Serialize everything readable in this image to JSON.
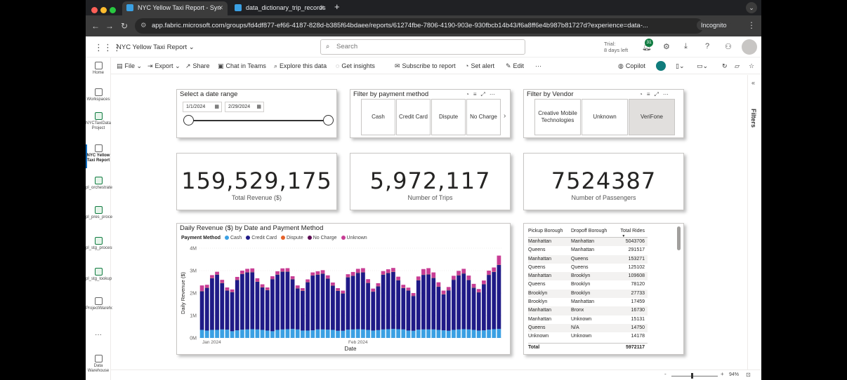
{
  "browser": {
    "tabs": [
      {
        "title": "NYC Yellow Taxi Report - Syn"
      },
      {
        "title": "data_dictionary_trip_records"
      }
    ],
    "url": "app.fabric.microsoft.com/groups/fd4df877-ef66-4187-828d-b385f64bdaee/reports/61274fbe-7806-4190-903e-930fbcb14b43/f6a8ff6e4b987b81727d?experience=data-...",
    "incognito_label": "Incognito"
  },
  "header": {
    "report_title": "NYC Yellow Taxi Report",
    "search_placeholder": "Search",
    "trial_line1": "Trial:",
    "trial_line2": "8 days left",
    "notification_count": "31"
  },
  "toolbar": {
    "file": "File",
    "export": "Export",
    "share": "Share",
    "chat_in_teams": "Chat in Teams",
    "explore": "Explore this data",
    "insights": "Get insights",
    "subscribe": "Subscribe to report",
    "set_alert": "Set alert",
    "edit": "Edit",
    "more": "···",
    "copilot": "Copilot"
  },
  "leftnav": {
    "items": [
      {
        "label": "Home"
      },
      {
        "label": "Workspaces"
      },
      {
        "label": "NYCTaxiData Project"
      },
      {
        "label": "NYC Yellow Taxi Report"
      },
      {
        "label": "pl_orchestrate_nyctaxi"
      },
      {
        "label": "pl_pres_processing_nyc..."
      },
      {
        "label": "pl_stg_processing_nyct..."
      },
      {
        "label": "pl_stg_lookup"
      },
      {
        "label": "ProjectWarehouse"
      },
      {
        "label": "···"
      },
      {
        "label": "Data Warehouse"
      }
    ]
  },
  "date_slicer": {
    "title": "Select a date range",
    "start": "1/1/2024",
    "end": "2/29/2024"
  },
  "payment_filter": {
    "title": "Filter by payment method",
    "options": [
      "Cash",
      "Credit Card",
      "Dispute",
      "No Charge"
    ]
  },
  "vendor_filter": {
    "title": "Filter by Vendor",
    "options": [
      "Creative Mobile Technologies",
      "Unknown",
      "VeriFone"
    ]
  },
  "kpis": [
    {
      "value": "159,529,175",
      "label": "Total Revenue ($)"
    },
    {
      "value": "5,972,117",
      "label": "Number of Trips"
    },
    {
      "value": "7524387",
      "label": "Number of Passengers"
    }
  ],
  "chart_data": {
    "type": "bar",
    "title": "Daily Revenue ($) by Date and Payment Method",
    "legend_title": "Payment Method",
    "xlabel": "Date",
    "ylabel": "Daily Revenue ($)",
    "x_tick_labels": [
      "Jan 2024",
      "Feb 2024"
    ],
    "y_tick_labels": [
      "0M",
      "1M",
      "2M",
      "3M",
      "4M"
    ],
    "ylim": [
      0,
      4000000
    ],
    "colors": {
      "Cash": "#3aa0e3",
      "Credit Card": "#1f1a87",
      "Dispute": "#e6632b",
      "No Charge": "#5c0a52",
      "Unknown": "#c83d95"
    },
    "categories": [
      "Jan 1",
      "Jan 2",
      "Jan 3",
      "Jan 4",
      "Jan 5",
      "Jan 6",
      "Jan 7",
      "Jan 8",
      "Jan 9",
      "Jan 10",
      "Jan 11",
      "Jan 12",
      "Jan 13",
      "Jan 14",
      "Jan 15",
      "Jan 16",
      "Jan 17",
      "Jan 18",
      "Jan 19",
      "Jan 20",
      "Jan 21",
      "Jan 22",
      "Jan 23",
      "Jan 24",
      "Jan 25",
      "Jan 26",
      "Jan 27",
      "Jan 28",
      "Jan 29",
      "Jan 30",
      "Jan 31",
      "Feb 1",
      "Feb 2",
      "Feb 3",
      "Feb 4",
      "Feb 5",
      "Feb 6",
      "Feb 7",
      "Feb 8",
      "Feb 9",
      "Feb 10",
      "Feb 11",
      "Feb 12",
      "Feb 13",
      "Feb 14",
      "Feb 15",
      "Feb 16",
      "Feb 17",
      "Feb 18",
      "Feb 19",
      "Feb 20",
      "Feb 21",
      "Feb 22",
      "Feb 23",
      "Feb 24",
      "Feb 25",
      "Feb 26",
      "Feb 27",
      "Feb 28",
      "Feb 29"
    ],
    "series": [
      {
        "name": "Cash",
        "values": [
          360000,
          330000,
          360000,
          360000,
          380000,
          370000,
          300000,
          340000,
          370000,
          380000,
          390000,
          380000,
          360000,
          330000,
          300000,
          360000,
          380000,
          390000,
          400000,
          380000,
          330000,
          330000,
          340000,
          380000,
          380000,
          370000,
          360000,
          320000,
          320000,
          370000,
          380000,
          390000,
          380000,
          360000,
          330000,
          350000,
          380000,
          390000,
          400000,
          390000,
          380000,
          330000,
          320000,
          370000,
          380000,
          380000,
          380000,
          360000,
          340000,
          320000,
          360000,
          380000,
          390000,
          380000,
          360000,
          330000,
          340000,
          370000,
          390000,
          400000
        ]
      },
      {
        "name": "Credit Card",
        "values": [
          1720000,
          1900000,
          2300000,
          2460000,
          2060000,
          1740000,
          1740000,
          2240000,
          2480000,
          2540000,
          2540000,
          2120000,
          1890000,
          1800000,
          2320000,
          2460000,
          2570000,
          2560000,
          2210000,
          1830000,
          1770000,
          2150000,
          2440000,
          2440000,
          2480000,
          2270000,
          1970000,
          1780000,
          1660000,
          2330000,
          2390000,
          2510000,
          2540000,
          2090000,
          1730000,
          1950000,
          2440000,
          2500000,
          2540000,
          2180000,
          1840000,
          1780000,
          1550000,
          2200000,
          2430000,
          2450000,
          2290000,
          1920000,
          1600000,
          1800000,
          2230000,
          2410000,
          2480000,
          2200000,
          1880000,
          1700000,
          2050000,
          2440000,
          2550000,
          2850000
        ]
      },
      {
        "name": "Dispute",
        "values": [
          10000,
          10000,
          10000,
          10000,
          10000,
          10000,
          10000,
          10000,
          10000,
          10000,
          10000,
          10000,
          10000,
          10000,
          10000,
          10000,
          10000,
          10000,
          10000,
          10000,
          10000,
          10000,
          10000,
          10000,
          10000,
          10000,
          10000,
          10000,
          10000,
          10000,
          10000,
          10000,
          10000,
          10000,
          10000,
          10000,
          10000,
          10000,
          10000,
          10000,
          10000,
          10000,
          10000,
          10000,
          10000,
          10000,
          10000,
          10000,
          10000,
          10000,
          10000,
          10000,
          10000,
          10000,
          10000,
          10000,
          10000,
          10000,
          10000,
          10000
        ]
      },
      {
        "name": "No Charge",
        "values": [
          10000,
          10000,
          10000,
          10000,
          10000,
          10000,
          10000,
          10000,
          10000,
          10000,
          10000,
          10000,
          10000,
          10000,
          10000,
          10000,
          10000,
          10000,
          10000,
          10000,
          10000,
          10000,
          10000,
          10000,
          10000,
          10000,
          10000,
          10000,
          10000,
          10000,
          10000,
          10000,
          10000,
          10000,
          10000,
          10000,
          10000,
          10000,
          10000,
          10000,
          10000,
          10000,
          10000,
          10000,
          10000,
          10000,
          10000,
          10000,
          10000,
          10000,
          10000,
          10000,
          10000,
          10000,
          10000,
          10000,
          10000,
          10000,
          10000,
          10000
        ]
      },
      {
        "name": "Unknown",
        "values": [
          240000,
          120000,
          120000,
          110000,
          130000,
          120000,
          100000,
          120000,
          130000,
          140000,
          150000,
          140000,
          120000,
          100000,
          110000,
          130000,
          130000,
          140000,
          120000,
          110000,
          100000,
          110000,
          120000,
          130000,
          140000,
          130000,
          120000,
          100000,
          110000,
          120000,
          150000,
          160000,
          170000,
          150000,
          120000,
          120000,
          140000,
          150000,
          160000,
          140000,
          130000,
          110000,
          110000,
          150000,
          240000,
          260000,
          230000,
          180000,
          150000,
          130000,
          160000,
          180000,
          190000,
          180000,
          150000,
          130000,
          150000,
          170000,
          180000,
          400000
        ]
      }
    ]
  },
  "rides_table": {
    "headers": [
      "Pickup Borough",
      "Dropoff Borough",
      "Total Rides"
    ],
    "rows": [
      [
        "Manhattan",
        "Manhattan",
        "5043706"
      ],
      [
        "Queens",
        "Manhattan",
        "291517"
      ],
      [
        "Manhattan",
        "Queens",
        "153271"
      ],
      [
        "Queens",
        "Queens",
        "125102"
      ],
      [
        "Manhattan",
        "Brooklyn",
        "109608"
      ],
      [
        "Queens",
        "Brooklyn",
        "78120"
      ],
      [
        "Brooklyn",
        "Brooklyn",
        "27733"
      ],
      [
        "Brooklyn",
        "Manhattan",
        "17459"
      ],
      [
        "Manhattan",
        "Bronx",
        "16730"
      ],
      [
        "Manhattan",
        "Unknown",
        "15131"
      ],
      [
        "Queens",
        "N/A",
        "14750"
      ],
      [
        "Unknown",
        "Unknown",
        "14178"
      ]
    ],
    "total_label": "Total",
    "total_value": "5972117"
  },
  "filters_pane": {
    "label": "Filters"
  },
  "status": {
    "zoom": "94%"
  }
}
